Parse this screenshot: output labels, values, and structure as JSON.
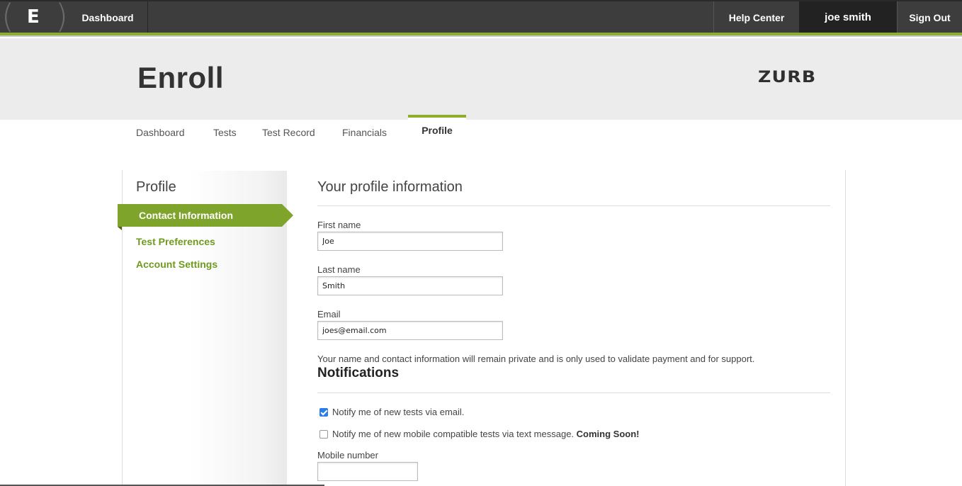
{
  "topbar": {
    "logo_letter": "E",
    "logo_paren_left": "(",
    "logo_paren_right": ")",
    "dashboard": "Dashboard",
    "help_center": "Help Center",
    "user_name": "joe smith",
    "sign_out": "Sign Out"
  },
  "header": {
    "title": "Enroll",
    "brand": "ZURB"
  },
  "tabs": [
    {
      "label": "Dashboard"
    },
    {
      "label": "Tests"
    },
    {
      "label": "Test Record"
    },
    {
      "label": "Financials"
    },
    {
      "label": "Profile",
      "active": true
    }
  ],
  "sidebar": {
    "title": "Profile",
    "items": [
      {
        "label": "Contact Information",
        "active": true
      },
      {
        "label": "Test Preferences"
      },
      {
        "label": "Account Settings"
      }
    ]
  },
  "profile": {
    "title": "Your profile information",
    "first_name_label": "First name",
    "first_name_value": "Joe",
    "last_name_label": "Last name",
    "last_name_value": "Smith",
    "email_label": "Email",
    "email_value": "joes@email.com",
    "privacy_note": "Your name and contact information will remain private and is only used to validate payment and for support."
  },
  "notifications": {
    "title": "Notifications",
    "email_option": "Notify me of new tests via email.",
    "email_checked": true,
    "text_option": "Notify me of new mobile compatible tests via text message.",
    "text_coming_soon": "Coming Soon!",
    "text_checked": false,
    "mobile_label": "Mobile number",
    "mobile_value": ""
  },
  "colors": {
    "accent_green": "#8dae2f",
    "topbar_bg": "#3d3d3d",
    "link_green": "#6f9a1e",
    "checkbox_blue": "#2b7de9"
  }
}
